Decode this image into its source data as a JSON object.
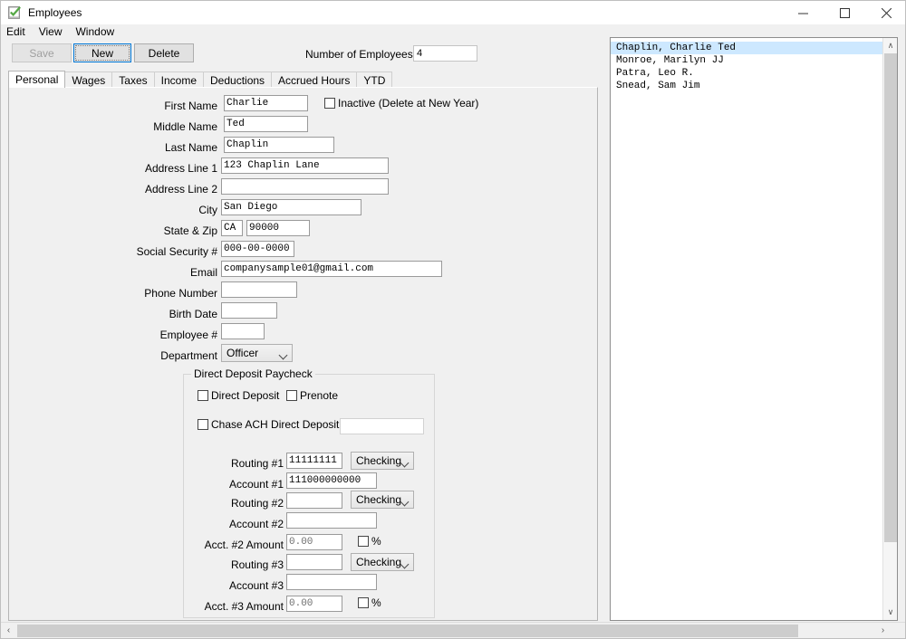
{
  "window": {
    "title": "Employees",
    "icon": "clipboard-check-icon",
    "minimize_label": "─",
    "maximize_label": "□",
    "close_label": "✕"
  },
  "menu": {
    "items": [
      {
        "label": "Edit"
      },
      {
        "label": "View"
      },
      {
        "label": "Window"
      }
    ]
  },
  "toolbar": {
    "save_label": "Save",
    "new_label": "New",
    "delete_label": "Delete",
    "num_employees_label": "Number of Employees:",
    "num_employees_value": "4"
  },
  "tabs": [
    {
      "label": "Personal",
      "active": true
    },
    {
      "label": "Wages",
      "active": false
    },
    {
      "label": "Taxes",
      "active": false
    },
    {
      "label": "Income",
      "active": false
    },
    {
      "label": "Deductions",
      "active": false
    },
    {
      "label": "Accrued Hours",
      "active": false
    },
    {
      "label": "YTD",
      "active": false
    }
  ],
  "personal": {
    "first_name_label": "First Name",
    "first_name_value": "Charlie",
    "middle_name_label": "Middle Name",
    "middle_name_value": "Ted",
    "last_name_label": "Last Name",
    "last_name_value": "Chaplin",
    "address1_label": "Address Line 1",
    "address1_value": "123 Chaplin Lane",
    "address2_label": "Address Line 2",
    "address2_value": "",
    "city_label": "City",
    "city_value": "San Diego",
    "state_zip_label": "State & Zip",
    "state_value": "CA",
    "zip_value": "90000",
    "ssn_label": "Social Security #",
    "ssn_value": "000-00-0000",
    "email_label": "Email",
    "email_value": "companysample01@gmail.com",
    "phone_label": "Phone Number",
    "phone_value": "",
    "birth_date_label": "Birth Date",
    "birth_date_value": "",
    "employee_num_label": "Employee #",
    "employee_num_value": "",
    "department_label": "Department",
    "department_value": "Officer",
    "inactive_label": "Inactive (Delete at New Year)",
    "inactive_checked": false
  },
  "direct_deposit": {
    "group_title": "Direct Deposit Paycheck",
    "direct_deposit_label": "Direct Deposit",
    "direct_deposit_checked": false,
    "prenote_label": "Prenote",
    "prenote_checked": false,
    "chase_ach_label": "Chase ACH Direct Deposit",
    "chase_ach_checked": false,
    "chase_ach_value": "",
    "routing1_label": "Routing #1",
    "routing1_value": "11111111",
    "account_type1_value": "Checking",
    "account1_label": "Account #1",
    "account1_value": "111000000000",
    "routing2_label": "Routing #2",
    "routing2_value": "",
    "account_type2_value": "Checking",
    "account2_label": "Account #2",
    "account2_value": "",
    "acct2_amount_label": "Acct. #2 Amount",
    "acct2_amount_value": "0.00",
    "acct2_percent_label": "%",
    "acct2_percent_checked": false,
    "routing3_label": "Routing #3",
    "routing3_value": "",
    "account_type3_value": "Checking",
    "account3_label": "Account #3",
    "account3_value": "",
    "acct3_amount_label": "Acct. #3 Amount",
    "acct3_amount_value": "0.00",
    "acct3_percent_label": "%",
    "acct3_percent_checked": false
  },
  "employee_list": {
    "items": [
      {
        "name": "Chaplin, Charlie Ted",
        "selected": true
      },
      {
        "name": "Monroe, Marilyn JJ",
        "selected": false
      },
      {
        "name": "Patra, Leo R.",
        "selected": false
      },
      {
        "name": "Snead, Sam Jim",
        "selected": false
      }
    ]
  },
  "scrollbars": {
    "up_arrow": "∧",
    "down_arrow": "∨",
    "left_arrow": "‹",
    "right_arrow": "›"
  },
  "colors": {
    "accent": "#0078d7",
    "selection": "#cde8ff",
    "window_bg": "#f0f0f0"
  }
}
